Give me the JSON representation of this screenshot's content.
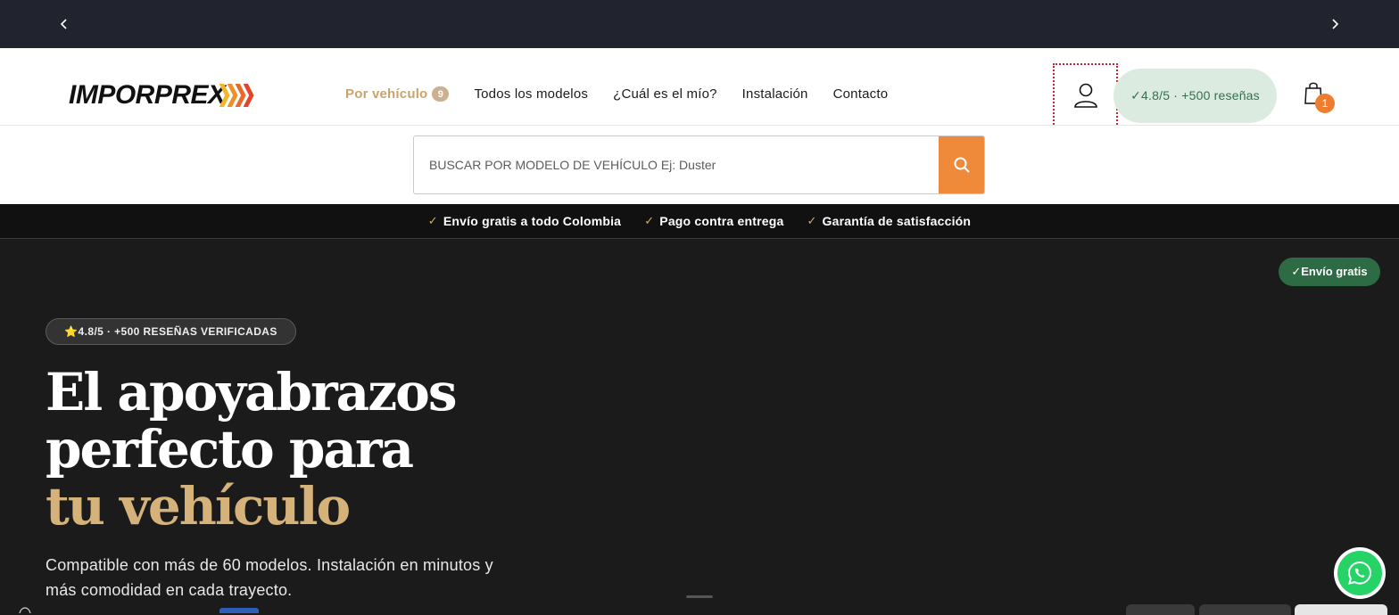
{
  "announcement": {
    "prev_icon": "chevron-left-icon",
    "next_icon": "chevron-right-icon"
  },
  "header": {
    "logo": {
      "part1": "IMPOR",
      "part2": "PREX",
      "chevron_colors": [
        "#f5b52a",
        "#f08f2c",
        "#e9692c",
        "#e0452d"
      ]
    },
    "nav": [
      {
        "label": "Por vehículo",
        "badge": "9",
        "active": true
      },
      {
        "label": "Todos los modelos"
      },
      {
        "label": "¿Cuál es el mío?"
      },
      {
        "label": "Instalación"
      },
      {
        "label": "Contacto"
      }
    ],
    "reviews_pill": "✓4.8/5 · +500 reseñas",
    "cart_count": "1"
  },
  "search": {
    "placeholder": "BUSCAR POR MODELO DE VEHÍCULO Ej: Duster",
    "button_icon": "search-icon"
  },
  "trust_bar": [
    "Envío gratis a todo Colombia",
    "Pago contra entrega",
    "Garantía de satisfacción"
  ],
  "hero": {
    "free_badge": "✓Envío gratis",
    "rating_badge": "⭐4.8/5 · +500 RESEÑAS VERIFICADAS",
    "title_line1": "El apoyabrazos",
    "title_line2": "perfecto para",
    "title_accent": "tu vehículo",
    "subtitle": "Compatible con más de 60 modelos. Instalación en minutos y más comodidad en cada trayecto."
  },
  "colors": {
    "accent_gold": "#d5b27a",
    "search_orange": "#ef8a3b",
    "badge_green": "#2c6b43",
    "announce_bg": "#21232e"
  }
}
